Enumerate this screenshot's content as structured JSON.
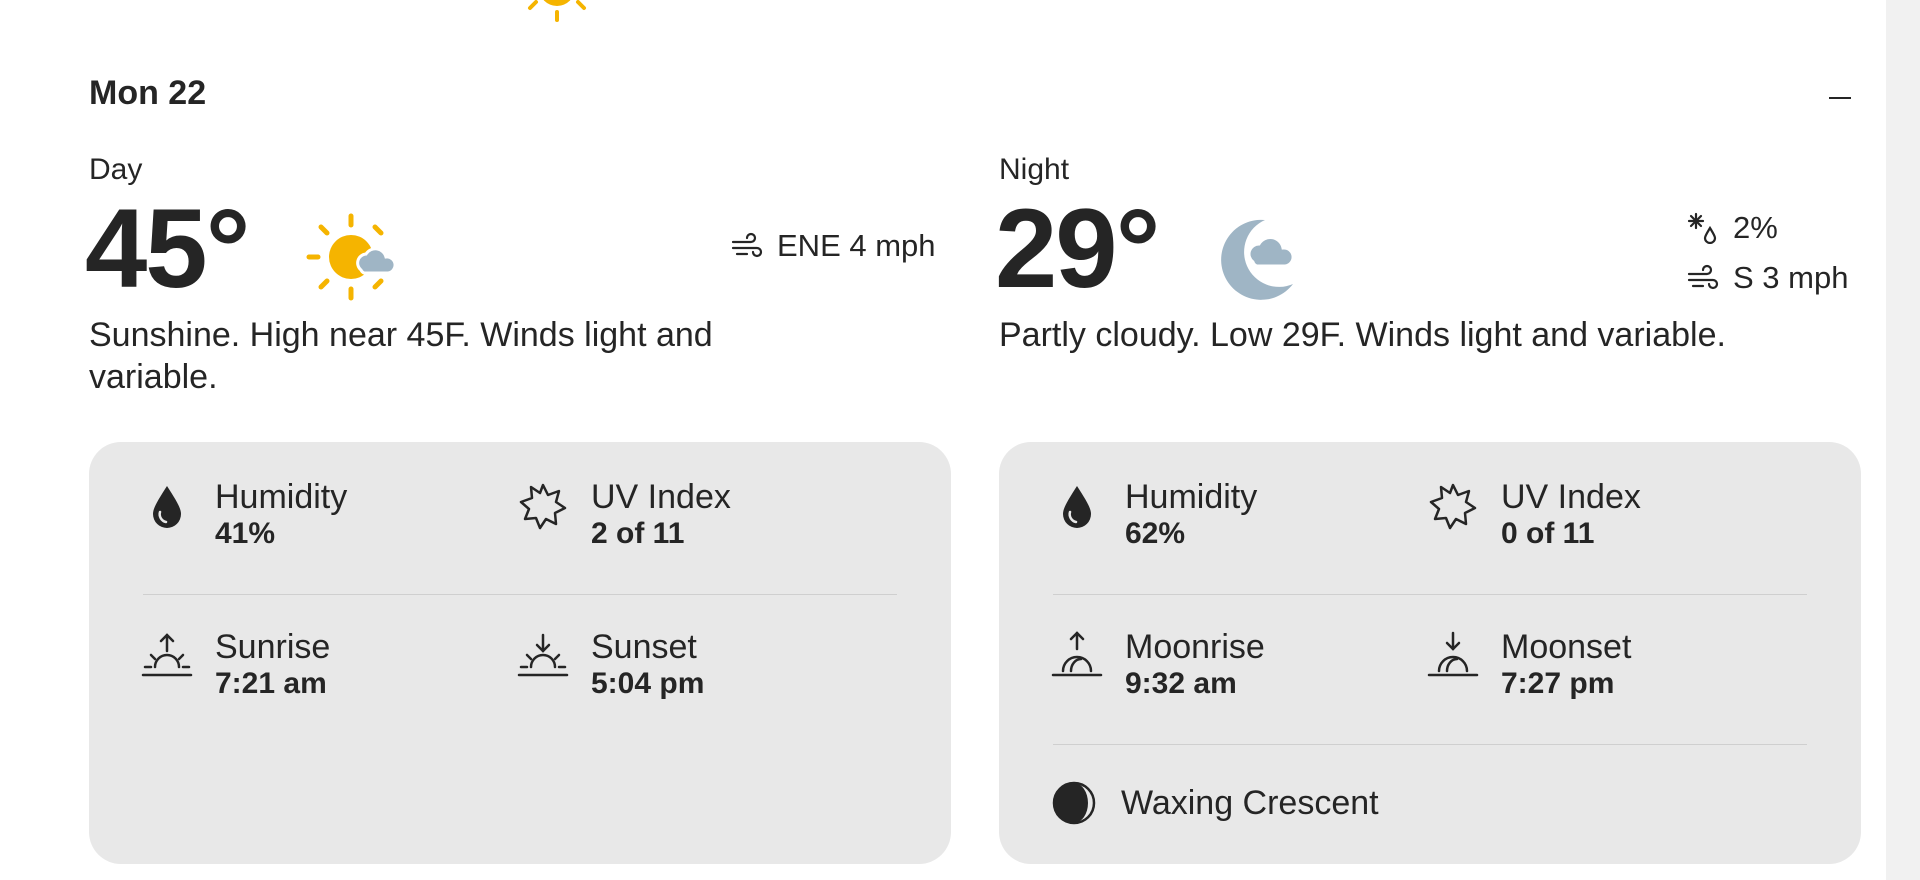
{
  "day_header": "Mon 22",
  "colors": {
    "sun": "#f5b400",
    "cloud": "#9fb5c5",
    "card_bg": "#e8e8e8",
    "text": "#252525"
  },
  "day": {
    "label": "Day",
    "temp": "45°",
    "icon": "sunny-partly-cloudy-icon",
    "wind": "ENE 4 mph",
    "narrative": "Sunshine. High near 45F. Winds light and variable.",
    "details": {
      "humidity_label": "Humidity",
      "humidity_value": "41%",
      "uv_label": "UV Index",
      "uv_value": "2 of 11",
      "sunrise_label": "Sunrise",
      "sunrise_value": "7:21 am",
      "sunset_label": "Sunset",
      "sunset_value": "5:04 pm"
    }
  },
  "night": {
    "label": "Night",
    "temp": "29°",
    "icon": "partly-cloudy-night-icon",
    "precip": "2%",
    "wind": "S 3 mph",
    "narrative": "Partly cloudy. Low 29F. Winds light and variable.",
    "details": {
      "humidity_label": "Humidity",
      "humidity_value": "62%",
      "uv_label": "UV Index",
      "uv_value": "0 of 11",
      "moonrise_label": "Moonrise",
      "moonrise_value": "9:32 am",
      "moonset_label": "Moonset",
      "moonset_value": "7:27 pm",
      "moon_phase": "Waxing Crescent"
    }
  }
}
